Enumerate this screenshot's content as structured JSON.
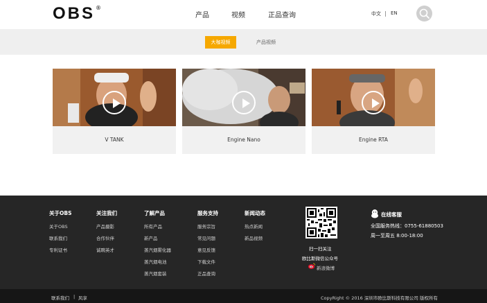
{
  "header": {
    "logo": "OBS",
    "logo_reg": "®",
    "nav": [
      "产品",
      "视频",
      "正品查询"
    ],
    "lang": [
      "中文",
      "EN"
    ]
  },
  "tabs": [
    "大咖视频",
    "产品视频"
  ],
  "videos": [
    {
      "title": "V TANK"
    },
    {
      "title": "Engine Nano"
    },
    {
      "title": "Engine RTA"
    }
  ],
  "footer": {
    "columns": [
      {
        "title": "关于OBS",
        "links": [
          "关于OBS",
          "联系我们",
          "专利证书"
        ]
      },
      {
        "title": "关注我们",
        "links": [
          "产品摄影",
          "合作伙伴",
          "诚聘英才"
        ]
      },
      {
        "title": "了解产品",
        "links": [
          "所有产品",
          "新产品",
          "蒸汽烟雾化器",
          "蒸汽烟电池",
          "蒸汽烟套装"
        ]
      },
      {
        "title": "服务支持",
        "links": [
          "服务宗旨",
          "常见问题",
          "意见反馈",
          "下载文件",
          "正品查询"
        ]
      },
      {
        "title": "新闻动态",
        "links": [
          "热点新闻",
          "新品视频"
        ]
      }
    ],
    "qr_caption": "扫一扫关注",
    "qr_sub": "欧比斯微信公众号",
    "weibo": "新浪微博",
    "service_title": "在线客服",
    "hotline": "全国服务热线：0755-61880503",
    "hours": "周一至周五 8:00-18:00"
  },
  "bottom": {
    "contact": "联系我们",
    "sep": "|",
    "share": "风享",
    "copyright": "CopyRight © 2016 深圳市欧比斯科技有限公司 版权所有"
  },
  "colors": {
    "accent": "#f6a800",
    "footer_bg": "#262626",
    "bottom_bg": "#161616"
  }
}
